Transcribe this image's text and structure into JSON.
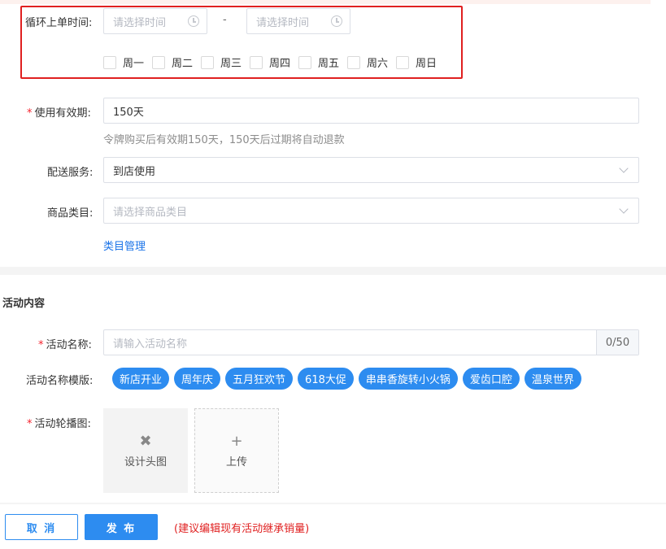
{
  "loop_order": {
    "label": "循环上单时间:",
    "start_placeholder": "请选择时间",
    "end_placeholder": "请选择时间",
    "separator": "-",
    "weekdays": [
      "周一",
      "周二",
      "周三",
      "周四",
      "周五",
      "周六",
      "周日"
    ]
  },
  "validity": {
    "label": "使用有效期:",
    "value": "150天",
    "hint": "令牌购买后有效期150天，150天后过期将自动退款"
  },
  "delivery": {
    "label": "配送服务:",
    "value": "到店使用"
  },
  "category": {
    "label": "商品类目:",
    "placeholder": "请选择商品类目",
    "manage_link": "类目管理"
  },
  "activity": {
    "section_title": "活动内容",
    "name_label": "活动名称:",
    "name_placeholder": "请输入活动名称",
    "name_counter": "0/50",
    "template_label": "活动名称模版:",
    "templates": [
      "新店开业",
      "周年庆",
      "五月狂欢节",
      "618大促",
      "串串香旋转小火锅",
      "爱齿口腔",
      "温泉世界"
    ],
    "carousel_label": "活动轮播图:",
    "design_tile": "设计头图",
    "upload_tile": "上传"
  },
  "footer": {
    "cancel_label": "取 消",
    "publish_label": "发 布",
    "notice": "(建议编辑现有活动继承销量)"
  },
  "colors": {
    "accent": "#2d8cf0",
    "required_star": "#f5222d",
    "highlight_border": "#e02020"
  }
}
